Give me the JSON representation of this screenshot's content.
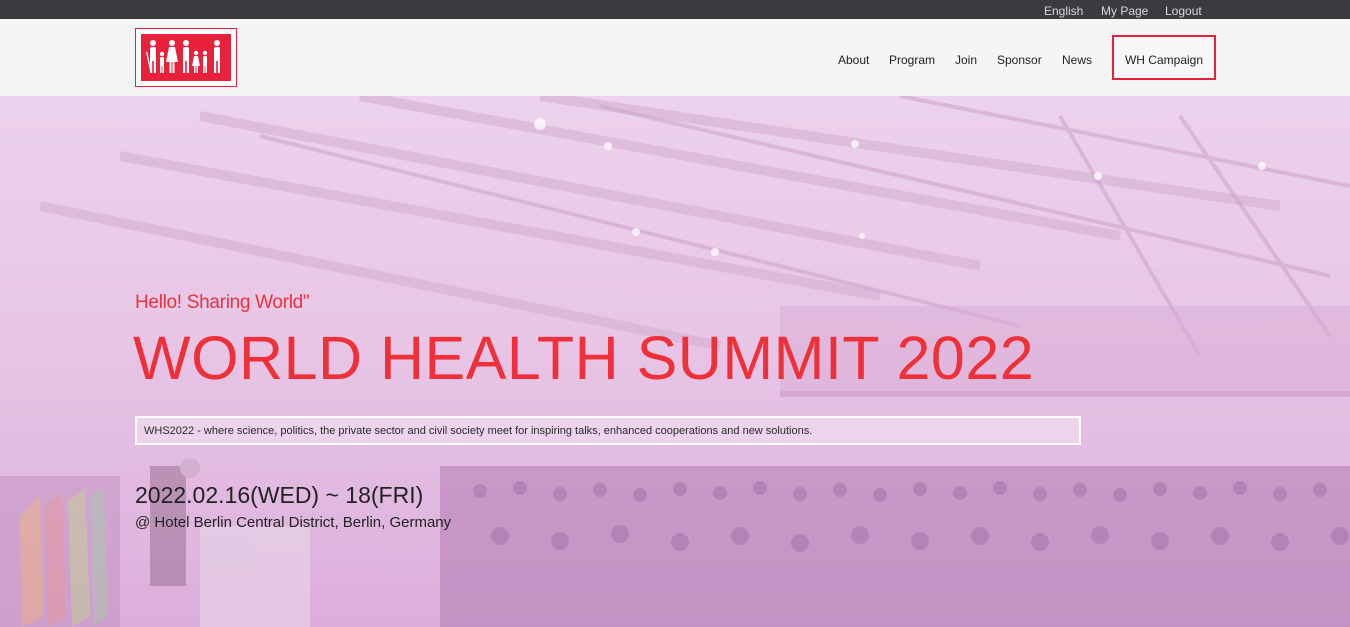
{
  "topbar": {
    "language": "English",
    "my_page": "My Page",
    "logout": "Logout"
  },
  "header": {
    "logo_icon": "family-figures-icon",
    "nav": {
      "about": "About",
      "program": "Program",
      "join": "Join",
      "sponsor": "Sponsor",
      "news": "News",
      "campaign": "WH Campaign"
    }
  },
  "hero": {
    "greeting": "Hello! Sharing World\"",
    "title": "WORLD HEALTH SUMMIT 2022",
    "description": "WHS2022 - where science, politics, the private sector and civil society meet for inspiring talks, enhanced cooperations and new solutions.",
    "date": "2022.02.16(WED) ~ 18(FRI)",
    "venue": "@ Hotel Berlin Central District, Berlin, Germany"
  },
  "colors": {
    "accent": "#e8213a",
    "topbar": "#3b3a3e",
    "hero_tint": "#e8c6e6"
  }
}
